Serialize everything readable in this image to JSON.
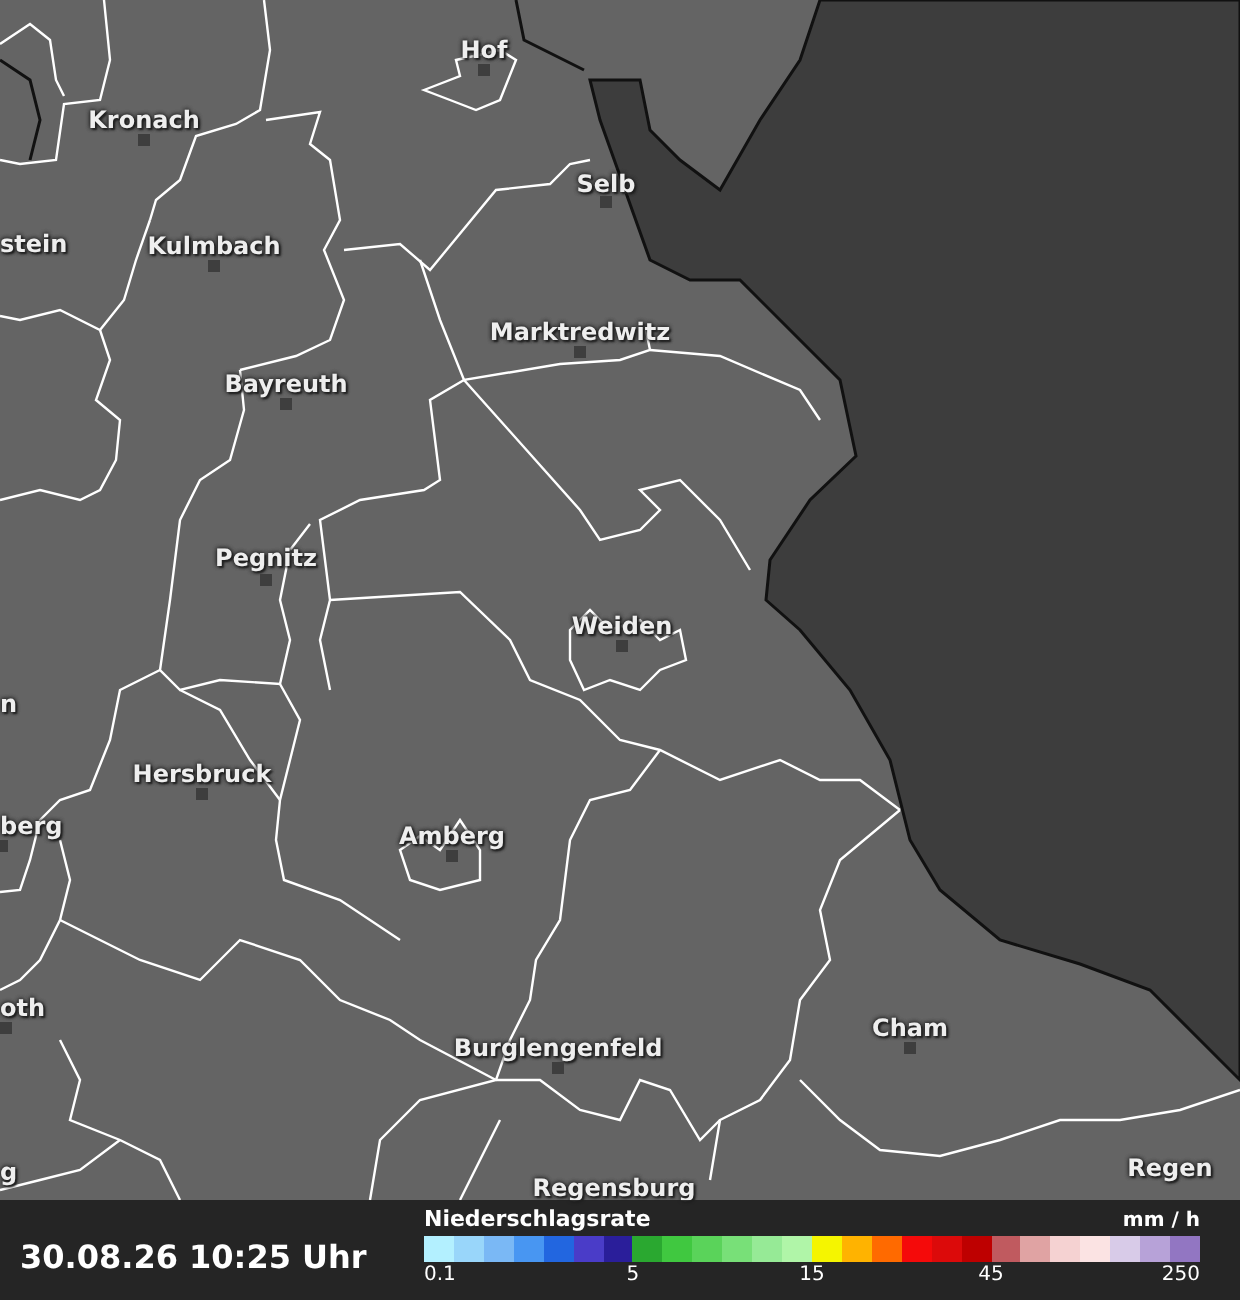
{
  "map": {
    "places": [
      {
        "name": "Hof",
        "dot": true
      },
      {
        "name": "Kronach",
        "dot": true
      },
      {
        "name": "Selb",
        "dot": true
      },
      {
        "name": "stein",
        "dot": false
      },
      {
        "name": "Kulmbach",
        "dot": true
      },
      {
        "name": "Marktredwitz",
        "dot": true
      },
      {
        "name": "Bayreuth",
        "dot": true
      },
      {
        "name": "Pegnitz",
        "dot": true
      },
      {
        "name": "Weiden",
        "dot": true
      },
      {
        "name": "n",
        "dot": false
      },
      {
        "name": "Hersbruck",
        "dot": true
      },
      {
        "name": "berg",
        "dot": true
      },
      {
        "name": "Amberg",
        "dot": true
      },
      {
        "name": "oth",
        "dot": true
      },
      {
        "name": "Cham",
        "dot": true
      },
      {
        "name": "Burglengenfeld",
        "dot": true
      },
      {
        "name": "g",
        "dot": false
      },
      {
        "name": "Regensburg",
        "dot": false
      },
      {
        "name": "Regen",
        "dot": false
      }
    ]
  },
  "footer": {
    "timestamp": "30.08.26 10:25 Uhr",
    "legend": {
      "title": "Niederschlagsrate",
      "unit": "mm / h",
      "cells": [
        {
          "color": "#b3f0ff"
        },
        {
          "color": "#99d6fa"
        },
        {
          "color": "#7ab8f5"
        },
        {
          "color": "#4896f2"
        },
        {
          "color": "#2266e0"
        },
        {
          "color": "#4a3cc8"
        },
        {
          "color": "#2a1e9a"
        },
        {
          "color": "#2aa830"
        },
        {
          "color": "#40c840"
        },
        {
          "color": "#5ad35a"
        },
        {
          "color": "#78e078"
        },
        {
          "color": "#96ea96"
        },
        {
          "color": "#b0f5a8"
        },
        {
          "color": "#f5f500"
        },
        {
          "color": "#ffb300"
        },
        {
          "color": "#ff6a00"
        },
        {
          "color": "#f50a0a"
        },
        {
          "color": "#dc0a0a"
        },
        {
          "color": "#be0000"
        },
        {
          "color": "#c05a5f"
        },
        {
          "color": "#e0a3a3"
        },
        {
          "color": "#f5d2d2"
        },
        {
          "color": "#fbe3e3"
        },
        {
          "color": "#d8cbe8"
        },
        {
          "color": "#b7a2d8"
        },
        {
          "color": "#9276c2"
        }
      ],
      "ticks": [
        {
          "label": "0.1"
        },
        {
          "label": "5"
        },
        {
          "label": "15"
        },
        {
          "label": "45"
        },
        {
          "label": "250"
        }
      ]
    }
  }
}
